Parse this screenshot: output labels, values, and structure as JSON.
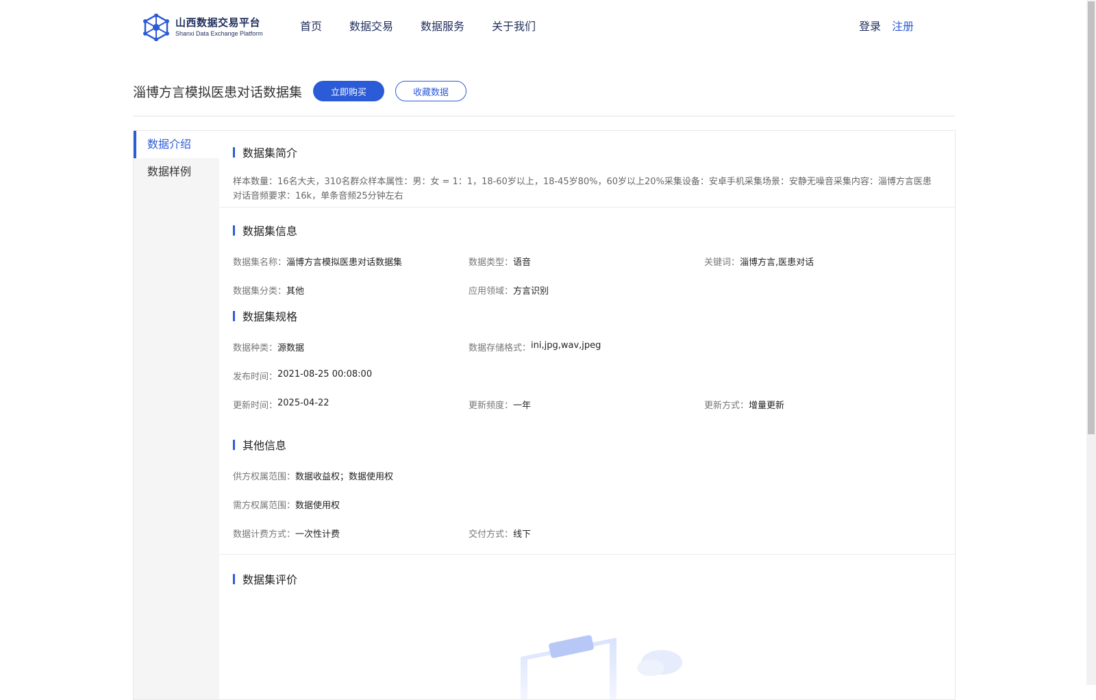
{
  "header": {
    "logo_cn": "山西数据交易平台",
    "logo_en": "Shanxi Data Exchange Platform",
    "nav": [
      "首页",
      "数据交易",
      "数据服务",
      "关于我们"
    ],
    "login": "登录",
    "register": "注册"
  },
  "title": {
    "name": "淄博方言模拟医患对话数据集",
    "buy_label": "立即购买",
    "fav_label": "收藏数据"
  },
  "sidebar": {
    "items": [
      {
        "label": "数据介绍",
        "active": true
      },
      {
        "label": "数据样例",
        "active": false
      }
    ]
  },
  "intro": {
    "heading": "数据集简介",
    "text": "样本数量：16名大夫，310名群众样本属性：男：女 = 1：1，18-60岁以上，18-45岁80%，60岁以上20%采集设备：安卓手机采集场景：安静无噪音采集内容：淄博方言医患对话音频要求：16k，单条音频25分钟左右"
  },
  "info": {
    "heading": "数据集信息",
    "name_k": "数据集名称：",
    "name_v": "淄博方言模拟医患对话数据集",
    "type_k": "数据类型：",
    "type_v": "语音",
    "kw_k": "关键词：",
    "kw_v": "淄博方言,医患对话",
    "cat_k": "数据集分类：",
    "cat_v": "其他",
    "field_k": "应用领域：",
    "field_v": "方言识别"
  },
  "spec": {
    "heading": "数据集规格",
    "kind_k": "数据种类：",
    "kind_v": "源数据",
    "fmt_k": "数据存储格式：",
    "fmt_v": "ini,jpg,wav,jpeg",
    "pub_k": "发布时间：",
    "pub_v": "2021-08-25 00:08:00",
    "upd_k": "更新时间：",
    "upd_v": "2025-04-22",
    "freq_k": "更新频度：",
    "freq_v": "一年",
    "mode_k": "更新方式：",
    "mode_v": "增量更新"
  },
  "other": {
    "heading": "其他信息",
    "supply_k": "供方权属范围：",
    "supply_v": "数据收益权；数据使用权",
    "demand_k": "需方权属范围：",
    "demand_v": "数据使用权",
    "billing_k": "数据计费方式：",
    "billing_v": "一次性计费",
    "delivery_k": "交付方式：",
    "delivery_v": "线下"
  },
  "review": {
    "heading": "数据集评价"
  },
  "colors": {
    "accent": "#2b5bd7",
    "nav_text": "#1f2d5c"
  }
}
